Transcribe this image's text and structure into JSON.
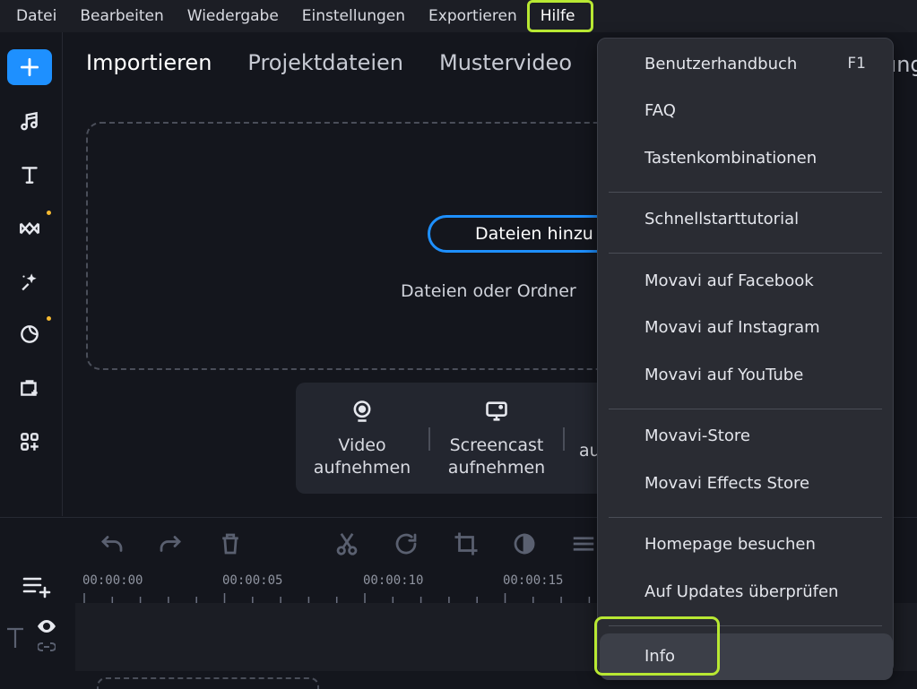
{
  "menubar": {
    "items": [
      "Datei",
      "Bearbeiten",
      "Wiedergabe",
      "Einstellungen",
      "Exportieren",
      "Hilfe"
    ],
    "active": "Hilfe"
  },
  "sidebar": {
    "icons": [
      "add-icon",
      "music-icon",
      "text-icon",
      "transitions-icon",
      "magic-icon",
      "stickers-icon",
      "store-icon",
      "more-tools-icon"
    ]
  },
  "tabs": {
    "items": [
      "Importieren",
      "Projektdateien",
      "Mustervideo"
    ],
    "overflow": "ung"
  },
  "import": {
    "add_files_label": "Dateien hinzu",
    "drop_hint": "Dateien oder Ordner"
  },
  "record": {
    "video": "Video\naufnehmen",
    "screencast": "Screencast\naufnehmen",
    "audio_partial": "au"
  },
  "timeline": {
    "times": [
      "00:00:00",
      "00:00:05",
      "00:00:10",
      "00:00:15"
    ]
  },
  "help_menu": {
    "groups": [
      [
        {
          "label": "Benutzerhandbuch",
          "shortcut": "F1"
        },
        {
          "label": "FAQ"
        },
        {
          "label": "Tastenkombinationen"
        }
      ],
      [
        {
          "label": "Schnellstarttutorial"
        }
      ],
      [
        {
          "label": "Movavi auf Facebook"
        },
        {
          "label": "Movavi auf Instagram"
        },
        {
          "label": "Movavi auf YouTube"
        }
      ],
      [
        {
          "label": "Movavi-Store"
        },
        {
          "label": "Movavi Effects Store"
        }
      ],
      [
        {
          "label": "Homepage besuchen"
        },
        {
          "label": "Auf Updates überprüfen"
        }
      ],
      [
        {
          "label": "Info"
        }
      ]
    ],
    "hovered": "Info"
  },
  "colors": {
    "accent": "#1e90ff",
    "highlight": "#b8e833",
    "badge": "#f5b931"
  }
}
